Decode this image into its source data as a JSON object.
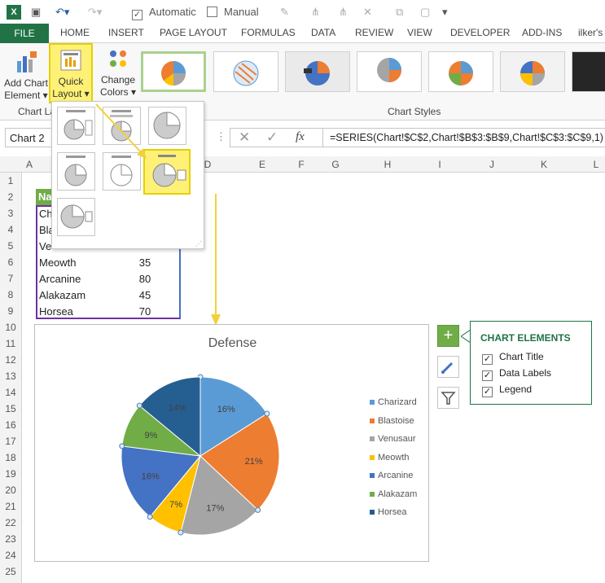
{
  "qat": {
    "automatic_label": "Automatic",
    "manual_label": "Manual"
  },
  "tabs": [
    "FILE",
    "HOME",
    "INSERT",
    "PAGE LAYOUT",
    "FORMULAS",
    "DATA",
    "REVIEW",
    "VIEW",
    "DEVELOPER",
    "ADD-INS",
    "ilker's"
  ],
  "ribbon": {
    "add_chart_element": [
      "Add Chart",
      "Element ▾"
    ],
    "quick_layout": [
      "Quick",
      "Layout ▾"
    ],
    "change_colors": [
      "Change",
      "Colors ▾"
    ],
    "group_chart_layouts": "Chart La",
    "group_chart_styles": "Chart Styles"
  },
  "formula": {
    "name_box": "Chart 2",
    "fx": "fx",
    "text": "=SERIES(Chart!$C$2,Chart!$B$3:$B$9,Chart!$C$3:$C$9,1)"
  },
  "columns": [
    "A",
    "B",
    "C",
    "D",
    "E",
    "F",
    "G",
    "H",
    "I",
    "J",
    "K",
    "L"
  ],
  "rows": [
    "1",
    "2",
    "3",
    "4",
    "5",
    "6",
    "7",
    "8",
    "9",
    "10",
    "11",
    "12",
    "13",
    "14",
    "15",
    "16",
    "17",
    "18",
    "19",
    "20",
    "21",
    "22",
    "23",
    "24",
    "25"
  ],
  "sheet": {
    "header_fragment": "Na",
    "partial_names": [
      "Ch",
      "Bla",
      "Ve"
    ],
    "rows": [
      {
        "name": "Meowth",
        "value": "35"
      },
      {
        "name": "Arcanine",
        "value": "80"
      },
      {
        "name": "Alakazam",
        "value": "45"
      },
      {
        "name": "Horsea",
        "value": "70"
      }
    ]
  },
  "chart": {
    "title": "Defense",
    "colors": {
      "Charizard": "#5b9bd5",
      "Blastoise": "#ed7d31",
      "Venusaur": "#a5a5a5",
      "Meowth": "#ffc000",
      "Arcanine": "#4472c4",
      "Alakazam": "#70ad47",
      "Horsea": "#255e91"
    }
  },
  "chart_data": {
    "type": "pie",
    "title": "Defense",
    "categories": [
      "Charizard",
      "Blastoise",
      "Venusaur",
      "Meowth",
      "Arcanine",
      "Alakazam",
      "Horsea"
    ],
    "values": [
      16,
      21,
      17,
      7,
      16,
      9,
      14
    ],
    "data_labels": [
      "16%",
      "21%",
      "17%",
      "7%",
      "16%",
      "9%",
      "14%"
    ],
    "legend": "right"
  },
  "chart_elements": {
    "title": "CHART ELEMENTS",
    "items": [
      {
        "label": "Chart Title",
        "checked": true
      },
      {
        "label": "Data Labels",
        "checked": true
      },
      {
        "label": "Legend",
        "checked": true
      }
    ]
  }
}
